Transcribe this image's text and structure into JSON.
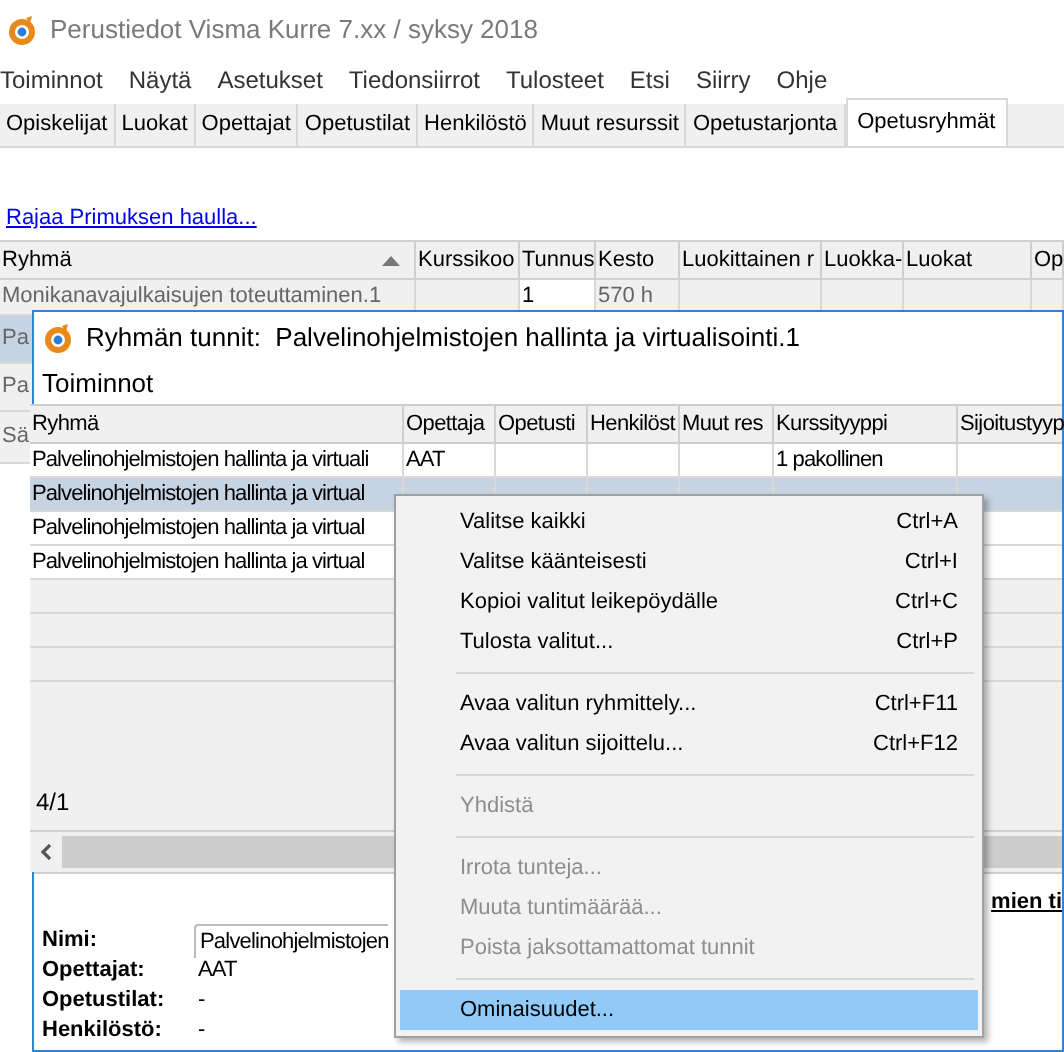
{
  "window": {
    "title": "Perustiedot Visma Kurre 7.xx / syksy 2018"
  },
  "menu": [
    "Toiminnot",
    "Näytä",
    "Asetukset",
    "Tiedonsiirrot",
    "Tulosteet",
    "Etsi",
    "Siirry",
    "Ohje"
  ],
  "tabs": [
    {
      "label": "Opiskelijat",
      "selected": false
    },
    {
      "label": "Luokat",
      "selected": false
    },
    {
      "label": "Opettajat",
      "selected": false
    },
    {
      "label": "Opetustilat",
      "selected": false
    },
    {
      "label": "Henkilöstö",
      "selected": false
    },
    {
      "label": "Muut resurssit",
      "selected": false
    },
    {
      "label": "Opetustarjonta",
      "selected": false
    },
    {
      "label": "Opetusryhmät",
      "selected": true
    }
  ],
  "filter_link": "Rajaa Primuksen haulla...",
  "table": {
    "columns": [
      "Ryhmä",
      "Kurssikoo",
      "Tunnus",
      "Kesto",
      "Luokittainen r",
      "Luokka-",
      "Luokat",
      "Op"
    ],
    "rows": [
      {
        "cells": [
          "Monikanavajulkaisujen toteuttaminen.1",
          "",
          "1",
          "570 h",
          "",
          "",
          "",
          ""
        ],
        "selected": false
      },
      {
        "cells": [
          "Pa"
        ],
        "selected": true
      },
      {
        "cells": [
          "Pa"
        ],
        "selected": false
      },
      {
        "cells": [
          "Sä"
        ],
        "selected": false
      }
    ]
  },
  "dialog": {
    "title": "Ryhmän tunnit:  Palvelinohjelmistojen hallinta ja virtualisointi.1",
    "menu": [
      "Toiminnot"
    ],
    "grid": {
      "columns": [
        "Ryhmä",
        "Opettaja",
        "Opetusti",
        "Henkilöst",
        "Muut res",
        "Kurssityyppi",
        "Sijoitustyyp"
      ],
      "rows": [
        {
          "cells": [
            "Palvelinohjelmistojen hallinta ja virtuali",
            "AAT",
            "",
            "",
            "",
            "1 pakollinen",
            ""
          ],
          "selected": false
        },
        {
          "cells": [
            "Palvelinohjelmistojen hallinta ja virtual"
          ],
          "selected": true
        },
        {
          "cells": [
            "Palvelinohjelmistojen hallinta ja virtual"
          ],
          "selected": false
        },
        {
          "cells": [
            "Palvelinohjelmistojen hallinta ja virtual"
          ],
          "selected": false
        }
      ]
    },
    "status": "4/1",
    "details_link": "mien ti",
    "details": [
      {
        "label": "Nimi:",
        "value": "Palvelinohjelmistojen"
      },
      {
        "label": "Opettajat:",
        "value": "AAT"
      },
      {
        "label": "Opetustilat:",
        "value": "-"
      },
      {
        "label": "Henkilöstö:",
        "value": "-"
      }
    ]
  },
  "context_menu": {
    "items": [
      {
        "kind": "item",
        "label": "Valitse kaikki",
        "shortcut": "Ctrl+A",
        "disabled": false,
        "selected": false
      },
      {
        "kind": "item",
        "label": "Valitse käänteisesti",
        "shortcut": "Ctrl+I",
        "disabled": false,
        "selected": false
      },
      {
        "kind": "item",
        "label": "Kopioi valitut leikepöydälle",
        "shortcut": "Ctrl+C",
        "disabled": false,
        "selected": false
      },
      {
        "kind": "item",
        "label": "Tulosta valitut...",
        "shortcut": "Ctrl+P",
        "disabled": false,
        "selected": false
      },
      {
        "kind": "separator"
      },
      {
        "kind": "item",
        "label": "Avaa valitun ryhmittely...",
        "shortcut": "Ctrl+F11",
        "disabled": false,
        "selected": false
      },
      {
        "kind": "item",
        "label": "Avaa valitun sijoittelu...",
        "shortcut": "Ctrl+F12",
        "disabled": false,
        "selected": false
      },
      {
        "kind": "separator"
      },
      {
        "kind": "item",
        "label": "Yhdistä",
        "disabled": true,
        "selected": false
      },
      {
        "kind": "separator"
      },
      {
        "kind": "item",
        "label": "Irrota tunteja...",
        "disabled": true,
        "selected": false
      },
      {
        "kind": "item",
        "label": "Muuta tuntimäärää...",
        "disabled": true,
        "selected": false
      },
      {
        "kind": "item",
        "label": "Poista jaksottamattomat tunnit",
        "disabled": true,
        "selected": false
      },
      {
        "kind": "separator"
      },
      {
        "kind": "item",
        "label": "Ominaisuudet...",
        "disabled": false,
        "selected": true
      }
    ]
  }
}
